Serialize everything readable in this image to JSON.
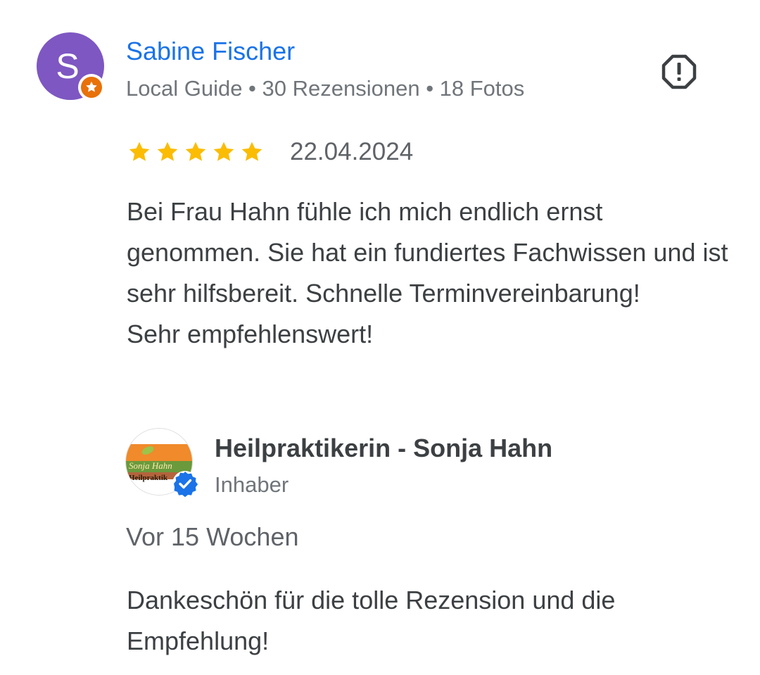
{
  "review": {
    "author": {
      "initial": "S",
      "name": "Sabine Fischer",
      "meta": "Local Guide • 30 Rezensionen • 18 Fotos",
      "avatar_color": "#7e57c2",
      "badge": "local-guide-star-icon",
      "badge_color": "#e8710a"
    },
    "report_icon": "report-icon",
    "rating": 5,
    "rating_max": 5,
    "star_color": "#fbbc04",
    "date": "22.04.2024",
    "text_lines": [
      "Bei Frau Hahn fühle ich mich endlich ernst genommen. Sie hat ein fundiertes Fachwissen und ist sehr hilfsbereit. Schnelle Terminvereinbarung!",
      "Sehr empfehlenswert!"
    ]
  },
  "owner_reply": {
    "logo_text": "Sonja Hahn",
    "logo_subtext": "Heilpraktik",
    "verified_icon": "verified-check-icon",
    "verified_color": "#1a73e8",
    "name": "Heilpraktikerin - Sonja Hahn",
    "role": "Inhaber",
    "time": "Vor 15 Wochen",
    "text": "Dankeschön für die tolle Rezension und die Empfehlung!"
  }
}
